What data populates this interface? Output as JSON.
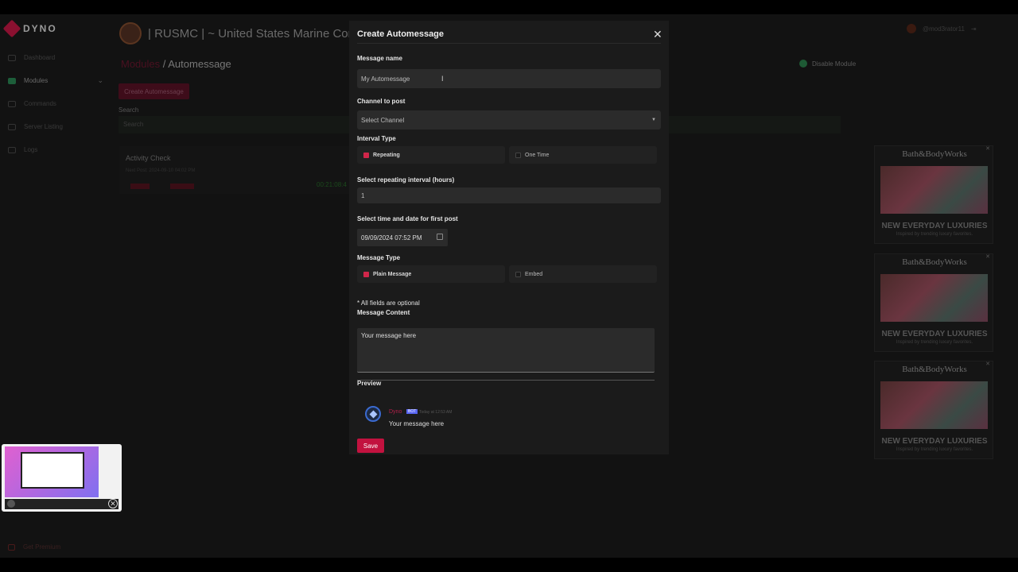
{
  "brand": {
    "name": "DYNO"
  },
  "sidebar": {
    "items": [
      {
        "label": "Dashboard"
      },
      {
        "label": "Modules"
      },
      {
        "label": "Commands"
      },
      {
        "label": "Server Listing"
      },
      {
        "label": "Logs"
      }
    ],
    "premium": "Get Premium"
  },
  "header": {
    "server_name": "| RUSMC | ~ United States Marine Corps",
    "user": "@mod3rator11"
  },
  "breadcrumb": {
    "parent": "Modules",
    "sep": " / ",
    "current": "Automessage"
  },
  "toolbar": {
    "create_label": "Create Automessage",
    "disable_label": "Disable Module"
  },
  "search": {
    "label": "Search",
    "placeholder": "Search"
  },
  "activity": {
    "title": "Activity Check",
    "next": "Next Post: 2024-09-10 04:02 PM",
    "countdown": "00:21:08:4"
  },
  "modal": {
    "title": "Create Automessage",
    "close": "✕",
    "message_name_label": "Message name",
    "message_name_value": "My Automessage",
    "channel_label": "Channel to post",
    "channel_value": "Select Channel",
    "interval_type_label": "Interval Type",
    "interval_options": [
      {
        "label": "Repeating",
        "checked": true
      },
      {
        "label": "One Time",
        "checked": false
      }
    ],
    "interval_hours_label": "Select repeating interval (hours)",
    "interval_hours_value": "1",
    "first_post_label": "Select time and date for first post",
    "first_post_value": "09/09/2024 07:52 PM",
    "message_type_label": "Message Type",
    "message_type_options": [
      {
        "label": "Plain Message",
        "checked": true
      },
      {
        "label": "Embed",
        "checked": false
      }
    ],
    "optional_note": "* All fields are optional",
    "content_label": "Message Content",
    "content_value": "Your message here",
    "preview_label": "Preview",
    "preview": {
      "name": "Dyno",
      "tag": "BOT",
      "timestamp": "Today at 12:53 AM",
      "message": "Your message here"
    },
    "save_label": "Save"
  },
  "ads": [
    {
      "brand": "Bath&BodyWorks",
      "headline": "NEW EVERYDAY LUXURIES",
      "sub": "Inspired by trending luxury favorites."
    },
    {
      "brand": "Bath&BodyWorks",
      "headline": "NEW EVERYDAY LUXURIES",
      "sub": "Inspired by trending luxury favorites."
    },
    {
      "brand": "Bath&BodyWorks",
      "headline": "NEW EVERYDAY LUXURIES",
      "sub": "Inspired by trending luxury favorites."
    }
  ],
  "colors": {
    "accent": "#c2123f",
    "checkbox": "#d0264a",
    "modal_bg": "#1b1b1b",
    "page_bg": "#121212"
  }
}
